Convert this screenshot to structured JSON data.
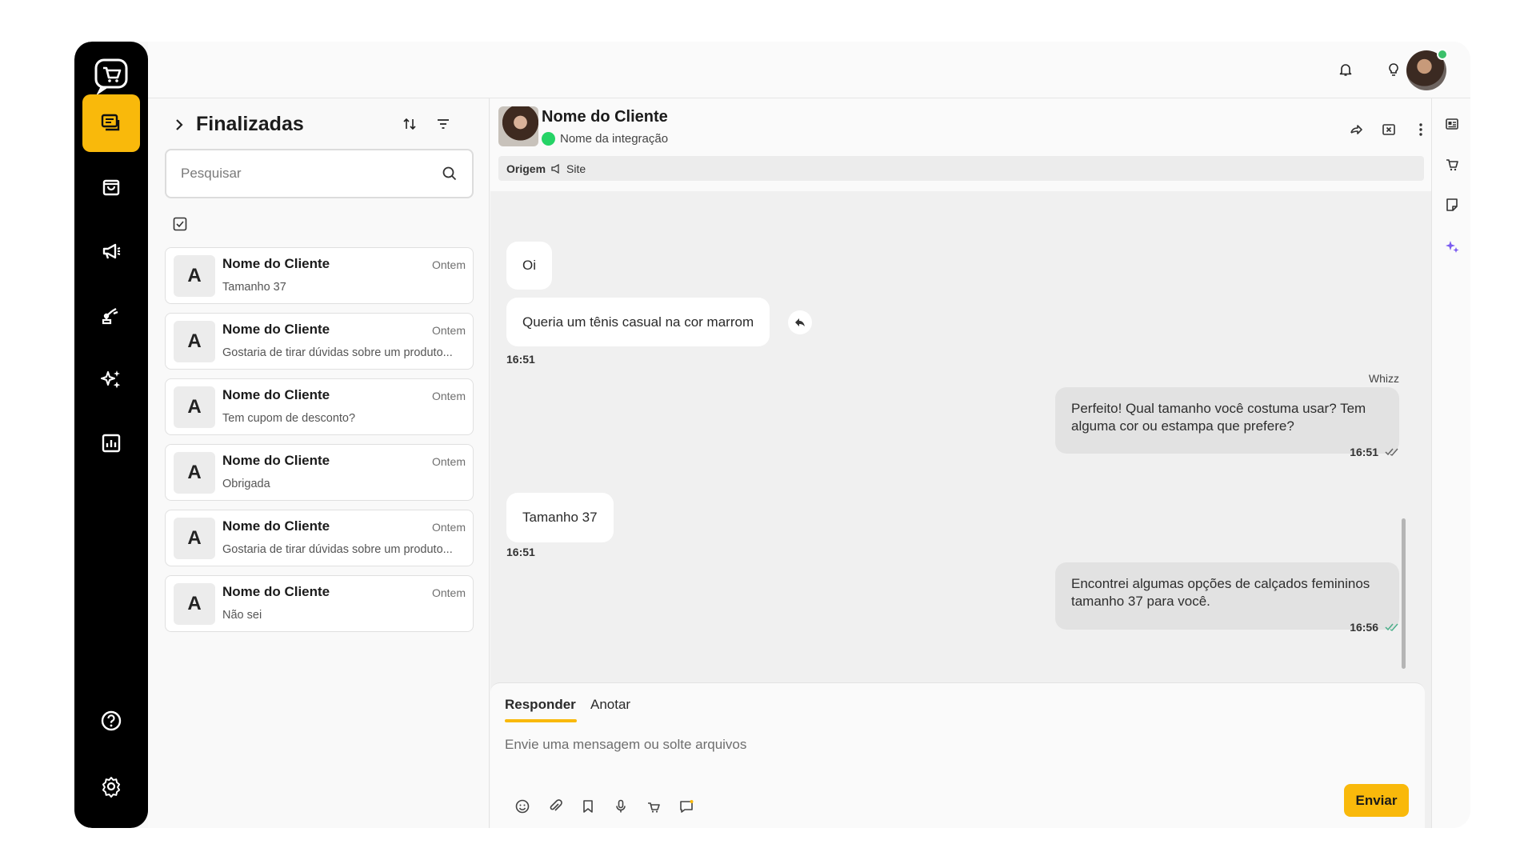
{
  "nav": {
    "items": [
      {
        "name": "conversations",
        "icon": "chat-icon",
        "active": true
      },
      {
        "name": "orders",
        "icon": "shopping-bag-icon"
      },
      {
        "name": "campaigns",
        "icon": "megaphone-icon"
      },
      {
        "name": "integrations",
        "icon": "robot-arm-icon"
      },
      {
        "name": "ai",
        "icon": "sparkles-icon"
      },
      {
        "name": "reports",
        "icon": "bar-chart-icon"
      }
    ],
    "bottom": [
      {
        "name": "help",
        "icon": "help-icon"
      },
      {
        "name": "settings",
        "icon": "gear-icon"
      }
    ]
  },
  "list": {
    "title": "Finalizadas",
    "search_placeholder": "Pesquisar",
    "conversations": [
      {
        "avatar": "A",
        "name": "Nome do Cliente",
        "time": "Ontem",
        "preview": "Tamanho 37"
      },
      {
        "avatar": "A",
        "name": "Nome do Cliente",
        "time": "Ontem",
        "preview": "Gostaria de tirar dúvidas sobre um produto..."
      },
      {
        "avatar": "A",
        "name": "Nome do Cliente",
        "time": "Ontem",
        "preview": "Tem cupom de desconto?"
      },
      {
        "avatar": "A",
        "name": "Nome do Cliente",
        "time": "Ontem",
        "preview": "Obrigada"
      },
      {
        "avatar": "A",
        "name": "Nome do Cliente",
        "time": "Ontem",
        "preview": "Gostaria de tirar dúvidas sobre um produto..."
      },
      {
        "avatar": "A",
        "name": "Nome do Cliente",
        "time": "Ontem",
        "preview": "Não sei"
      }
    ]
  },
  "chat": {
    "contact_name": "Nome do Cliente",
    "integration": "Nome da integração",
    "origin_label": "Origem",
    "origin_value": "Site",
    "messages": [
      {
        "dir": "in",
        "text": "Oi"
      },
      {
        "dir": "in",
        "text": "Queria um tênis casual na cor marrom",
        "time": "16:51"
      },
      {
        "dir": "out",
        "sender": "Whizz",
        "text": "Perfeito! Qual tamanho você costuma usar? Tem alguma cor ou estampa que prefere?",
        "time": "16:51"
      },
      {
        "dir": "in",
        "text": "Tamanho 37",
        "time": "16:51"
      },
      {
        "dir": "out",
        "text": "Encontrei algumas opções de calçados femininos tamanho 37 para você.",
        "time": "16:56"
      }
    ]
  },
  "composer": {
    "tab_reply": "Responder",
    "tab_note": "Anotar",
    "placeholder": "Envie uma mensagem ou solte arquivos",
    "send_label": "Enviar"
  },
  "colors": {
    "accent": "#f9b90b",
    "online": "#3cc06b",
    "read_check": "#4caf8a"
  }
}
